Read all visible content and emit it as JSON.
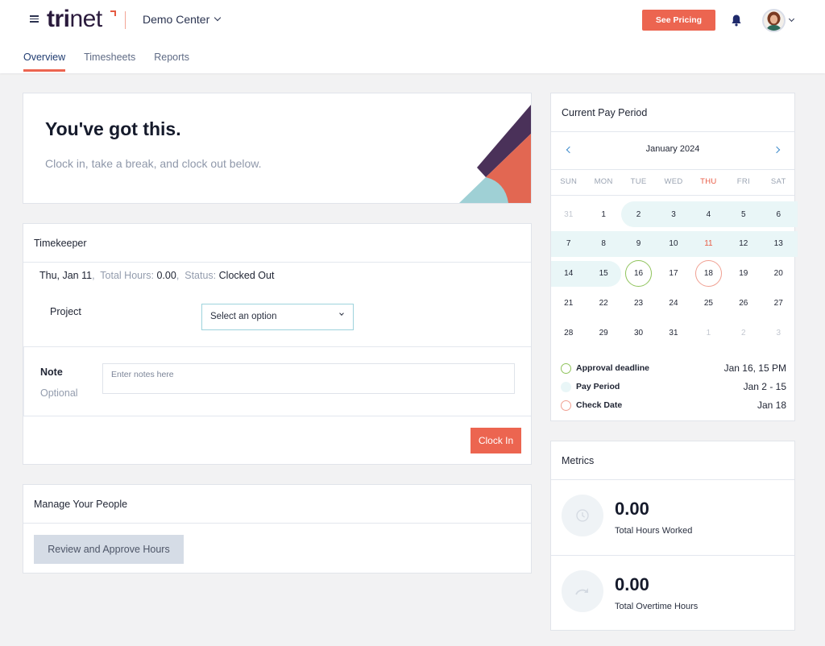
{
  "header": {
    "logo_bold": "tri",
    "logo_light": "net",
    "workspace": "Demo Center",
    "see_pricing": "See Pricing",
    "icons": {
      "menu": "hamburger-icon",
      "bell": "bell-icon",
      "avatar": "user-avatar"
    }
  },
  "tabs": [
    {
      "label": "Overview",
      "active": true
    },
    {
      "label": "Timesheets",
      "active": false
    },
    {
      "label": "Reports",
      "active": false
    }
  ],
  "hero": {
    "title": "You've got this.",
    "subtitle": "Clock in, take a break, and clock out below."
  },
  "timekeeper": {
    "title": "Timekeeper",
    "date": "Thu, Jan 11",
    "total_hours_label": "Total Hours:",
    "total_hours_value": "0.00",
    "status_label": "Status:",
    "status_value": "Clocked Out",
    "project_label": "Project",
    "project_select": "Select an option",
    "note_label": "Note",
    "note_optional": "Optional",
    "note_placeholder": "Enter notes here",
    "clock_in": "Clock In"
  },
  "manage_people": {
    "title": "Manage Your People",
    "review_button": "Review and Approve Hours"
  },
  "pay_period": {
    "title": "Current Pay Period",
    "month": "January 2024",
    "weekdays": [
      "SUN",
      "MON",
      "TUE",
      "WED",
      "THU",
      "FRI",
      "SAT"
    ],
    "today_weekday_index": 4,
    "weeks": [
      [
        "31",
        "1",
        "2",
        "3",
        "4",
        "5",
        "6"
      ],
      [
        "7",
        "8",
        "9",
        "10",
        "11",
        "12",
        "13"
      ],
      [
        "14",
        "15",
        "16",
        "17",
        "18",
        "19",
        "20"
      ],
      [
        "21",
        "22",
        "23",
        "24",
        "25",
        "26",
        "27"
      ],
      [
        "28",
        "29",
        "30",
        "31",
        "1",
        "2",
        "3"
      ]
    ],
    "today": "11",
    "approval_deadline_day": "16",
    "check_date_day": "18",
    "pay_period_range_days": [
      2,
      15
    ],
    "legend": [
      {
        "label": "Approval deadline",
        "value": "Jan 16, 15 PM",
        "color": "#8fc35b"
      },
      {
        "label": "Pay Period",
        "value": "Jan 2 - 15",
        "color": "#e9f6f7"
      },
      {
        "label": "Check Date",
        "value": "Jan 18",
        "color": "#f0a092"
      }
    ]
  },
  "metrics": {
    "title": "Metrics",
    "items": [
      {
        "value": "0.00",
        "label": "Total Hours Worked",
        "icon": "clock-icon"
      },
      {
        "value": "0.00",
        "label": "Total Overtime Hours",
        "icon": "redo-arrow-icon"
      }
    ]
  },
  "colors": {
    "accent": "#ec6550",
    "navy": "#1f3b70",
    "hero_purple": "#4a3159",
    "hero_orange": "#e26752",
    "hero_teal": "#9fd0d5"
  }
}
